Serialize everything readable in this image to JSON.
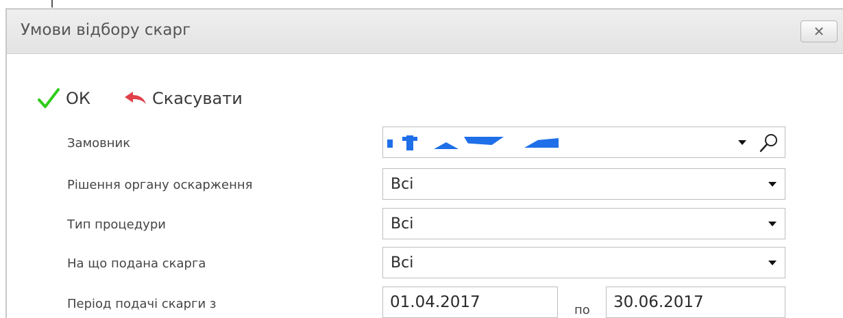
{
  "dialog": {
    "title": "Умови відбору скарг",
    "close_label": "✕"
  },
  "toolbar": {
    "ok_label": "ОК",
    "cancel_label": "Скасувати"
  },
  "fields": {
    "customer": {
      "label": "Замовник"
    },
    "appeal_decision": {
      "label": "Рішення органу оскарження",
      "value": "Всі"
    },
    "procedure_type": {
      "label": "Тип процедури",
      "value": "Всі"
    },
    "complaint_subject": {
      "label": "На що подана скарга",
      "value": "Всі"
    },
    "period": {
      "label": "Період подачі скарги з",
      "from": "01.04.2017",
      "to_label": "по",
      "to": "30.06.2017"
    }
  },
  "colors": {
    "ok_check": "#2ecc1a",
    "cancel_arrow": "#e0404a",
    "redaction": "#1f6fe8"
  },
  "icons": [
    "checkmark-icon",
    "undo-arrow-icon",
    "dropdown-arrow-icon",
    "search-icon",
    "close-icon"
  ]
}
